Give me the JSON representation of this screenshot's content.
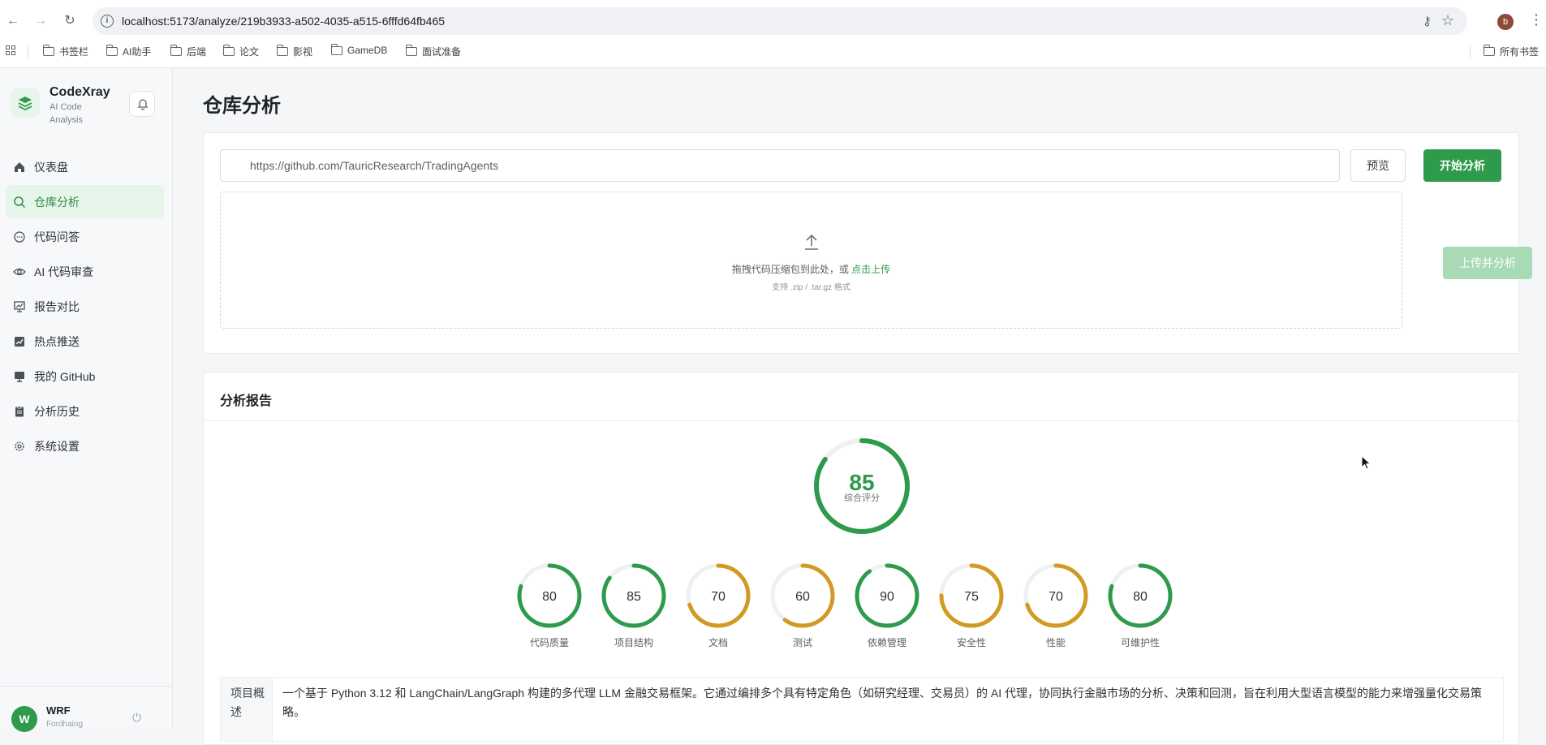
{
  "browser": {
    "url": "localhost:5173/analyze/219b3933-a502-4035-a515-6fffd64fb465",
    "profile_initial": "b",
    "bookmarks": [
      "书签栏",
      "AI助手",
      "后端",
      "论文",
      "影视",
      "GameDB",
      "面试准备"
    ],
    "all_bookmarks": "所有书签"
  },
  "sidebar": {
    "brand_name": "CodeXray",
    "brand_sub": "AI Code Analysis",
    "items": [
      {
        "label": "仪表盘",
        "icon": "home-icon"
      },
      {
        "label": "仓库分析",
        "icon": "search-icon",
        "active": true
      },
      {
        "label": "代码问答",
        "icon": "chat-icon"
      },
      {
        "label": "AI 代码审查",
        "icon": "eye-icon"
      },
      {
        "label": "报告对比",
        "icon": "compare-icon"
      },
      {
        "label": "热点推送",
        "icon": "trend-icon"
      },
      {
        "label": "我的 GitHub",
        "icon": "monitor-icon"
      },
      {
        "label": "分析历史",
        "icon": "clipboard-icon"
      },
      {
        "label": "系统设置",
        "icon": "gear-icon"
      }
    ],
    "user": {
      "initial": "W",
      "name": "WRF",
      "status": "Fordhaing"
    }
  },
  "main": {
    "page_title": "仓库分析",
    "repo_input_value": "https://github.com/TauricResearch/TradingAgents",
    "preview_label": "预览",
    "start_label": "开始分析",
    "drop_text": "拖拽代码压缩包到此处，或 ",
    "drop_link": "点击上传",
    "drop_sub": "支持 .zip / .tar.gz 格式",
    "upload_label": "上传并分析"
  },
  "report": {
    "title": "分析报告",
    "overall": {
      "score": 85,
      "label": "综合评分",
      "color": "#2e9a4c"
    },
    "metrics": [
      {
        "label": "代码质量",
        "score": 80,
        "color": "#2e9a4c"
      },
      {
        "label": "项目结构",
        "score": 85,
        "color": "#2e9a4c"
      },
      {
        "label": "文档",
        "score": 70,
        "color": "#d19a23"
      },
      {
        "label": "测试",
        "score": 60,
        "color": "#d19a23"
      },
      {
        "label": "依赖管理",
        "score": 90,
        "color": "#2e9a4c"
      },
      {
        "label": "安全性",
        "score": 75,
        "color": "#d19a23"
      },
      {
        "label": "性能",
        "score": 70,
        "color": "#d19a23"
      },
      {
        "label": "可维护性",
        "score": 80,
        "color": "#2e9a4c"
      }
    ],
    "summary_label": "项目概述",
    "summary_text": "一个基于 Python 3.12 和 LangChain/LangGraph 构建的多代理 LLM 金融交易框架。它通过编排多个具有特定角色（如研究经理、交易员）的 AI 代理，协同执行金融市场的分析、决策和回测，旨在利用大型语言模型的能力来增强量化交易策略。"
  }
}
